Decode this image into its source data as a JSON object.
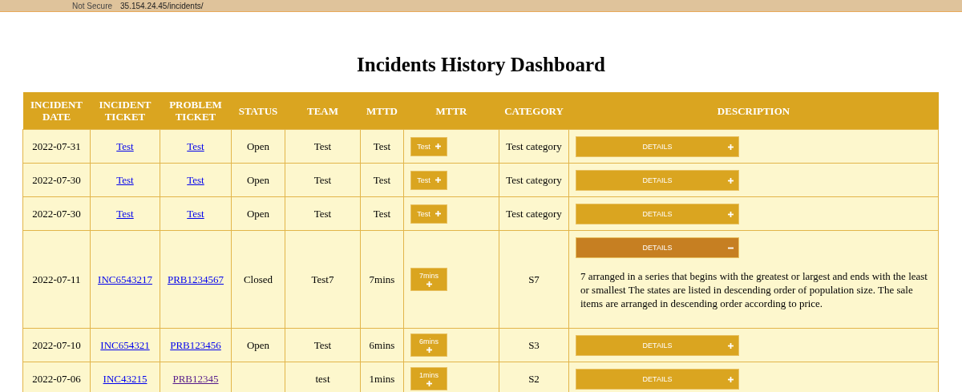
{
  "browser": {
    "security": "Not Secure",
    "address": "35.154.24.45/incidents/"
  },
  "title": "Incidents History Dashboard",
  "table": {
    "columns": [
      "INCIDENT DATE",
      "INCIDENT TICKET",
      "PROBLEM TICKET",
      "STATUS",
      "TEAM",
      "MTTD",
      "MTTR",
      "CATEGORY",
      "DESCRIPTION"
    ],
    "rows": [
      {
        "date": "2022-07-31",
        "incident_ticket": {
          "text": "Test",
          "visited": false
        },
        "problem_ticket": {
          "text": "Test",
          "visited": false
        },
        "status": "Open",
        "team": "Test",
        "mttd": "Test",
        "mttr": {
          "text": "Test",
          "expanded": false
        },
        "category": "Test category",
        "details": {
          "label": "DETAILS",
          "expanded": false
        }
      },
      {
        "date": "2022-07-30",
        "incident_ticket": {
          "text": "Test",
          "visited": false
        },
        "problem_ticket": {
          "text": "Test",
          "visited": false
        },
        "status": "Open",
        "team": "Test",
        "mttd": "Test",
        "mttr": {
          "text": "Test",
          "expanded": false
        },
        "category": "Test category",
        "details": {
          "label": "DETAILS",
          "expanded": false
        }
      },
      {
        "date": "2022-07-30",
        "incident_ticket": {
          "text": "Test",
          "visited": false
        },
        "problem_ticket": {
          "text": "Test",
          "visited": false
        },
        "status": "Open",
        "team": "Test",
        "mttd": "Test",
        "mttr": {
          "text": "Test",
          "expanded": false
        },
        "category": "Test category",
        "details": {
          "label": "DETAILS",
          "expanded": false
        }
      },
      {
        "date": "2022-07-11",
        "incident_ticket": {
          "text": "INC6543217",
          "visited": false
        },
        "problem_ticket": {
          "text": "PRB1234567",
          "visited": false
        },
        "status": "Closed",
        "team": "Test7",
        "mttd": "7mins",
        "mttr": {
          "text": "7mins",
          "expanded": false
        },
        "category": "S7",
        "details": {
          "label": "DETAILS",
          "expanded": true,
          "text": "7 arranged in a series that begins with the greatest or largest and ends with the least or smallest The states are listed in descending order of population size. The sale items are arranged in descending order according to price."
        }
      },
      {
        "date": "2022-07-10",
        "incident_ticket": {
          "text": "INC654321",
          "visited": false
        },
        "problem_ticket": {
          "text": "PRB123456",
          "visited": false
        },
        "status": "Open",
        "team": "Test",
        "mttd": "6mins",
        "mttr": {
          "text": "6mins",
          "expanded": false
        },
        "category": "S3",
        "details": {
          "label": "DETAILS",
          "expanded": false
        }
      },
      {
        "date": "2022-07-06",
        "incident_ticket": {
          "text": "INC43215",
          "visited": false
        },
        "problem_ticket": {
          "text": "PRB12345",
          "visited": true
        },
        "team": "test",
        "mttd": "1mins",
        "mttr": {
          "text": "1mins",
          "expanded": false
        },
        "category": "S2",
        "details": {
          "label": "DETAILS",
          "expanded": false
        }
      }
    ]
  }
}
